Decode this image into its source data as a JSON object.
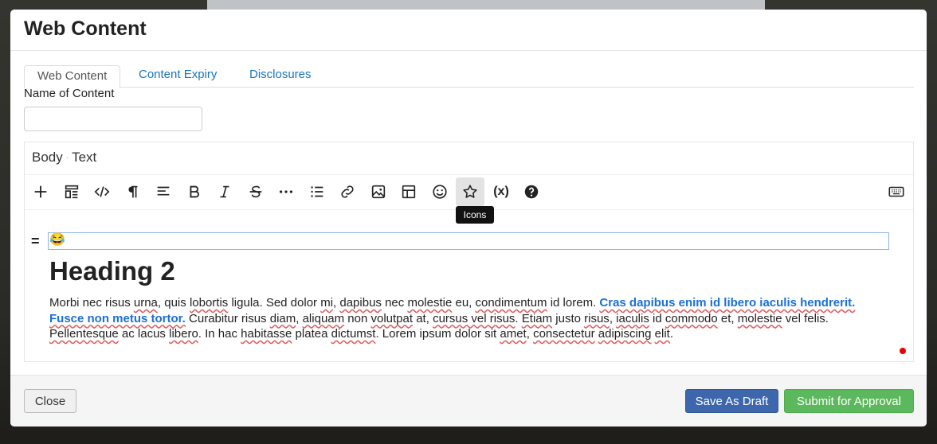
{
  "modal": {
    "title": "Web Content"
  },
  "tabs": [
    {
      "label": "Web Content",
      "active": true
    },
    {
      "label": "Content Expiry",
      "active": false
    },
    {
      "label": "Disclosures",
      "active": false
    }
  ],
  "form": {
    "name_label": "Name of Content",
    "name_value": ""
  },
  "editor": {
    "label_body": "Body",
    "label_text": "Text",
    "toolbar": [
      {
        "name": "plus-icon"
      },
      {
        "name": "layout-icon"
      },
      {
        "name": "code-icon"
      },
      {
        "name": "paragraph-icon"
      },
      {
        "name": "align-left-icon"
      },
      {
        "name": "bold-icon"
      },
      {
        "name": "italic-icon"
      },
      {
        "name": "strikethrough-icon"
      },
      {
        "name": "more-icon"
      },
      {
        "name": "list-icon"
      },
      {
        "name": "link-icon"
      },
      {
        "name": "image-icon"
      },
      {
        "name": "table-icon"
      },
      {
        "name": "emoji-icon"
      },
      {
        "name": "star-icon"
      },
      {
        "name": "variable-icon",
        "text": "(x)"
      },
      {
        "name": "help-icon"
      },
      {
        "name": "keyboard-icon"
      }
    ],
    "tooltip": "Icons",
    "drag_handle": "=",
    "emoji": "😂",
    "heading": "Heading 2",
    "paragraph": {
      "p1": "Morbi nec risus ",
      "w_urna": "urna",
      "p2": ", quis ",
      "w_lobortis": "lobortis",
      "p3": " ligula. Sed dolor ",
      "w_mi": "mi",
      "p4": ", ",
      "w_dapibus": "dapibus",
      "p5": " nec ",
      "w_molestie1": "molestie",
      "p6": " eu, ",
      "w_condimentum": "condimentum",
      "p7": " id lorem. ",
      "link1": "Cras dapibus enim id libero iaculis hendrerit.",
      "p8": " ",
      "link2": "Fusce non metus tortor.",
      "p9": " Curabitur risus ",
      "w_diam": "diam",
      "p10": ", ",
      "w_aliquam": "aliquam",
      "p11": " non ",
      "w_volutpat": "volutpat",
      "p12": " at, ",
      "w_cursus": "cursus vel risus",
      "p13": ". ",
      "w_etiam": "Etiam",
      "p14": " justo ",
      "w_risus": "risus",
      "p15": ", ",
      "w_iaculis": "iaculis",
      "p16": " id ",
      "w_commodo": "commodo",
      "p17": " et, ",
      "w_molestie2": "molestie",
      "p18": " vel felis. ",
      "w_pellentesque": "Pellentesque",
      "p19": " ac lacus ",
      "w_libero": "libero",
      "p20": ". In hac ",
      "w_habitasse": "habitasse",
      "p21": " platea ",
      "w_dictumst": "dictumst",
      "p22": ". Lorem ipsum dolor sit ",
      "w_amet": "amet",
      "p23": ", ",
      "w_consectetur": "consectetur",
      "p24": " ",
      "w_adipiscing": "adipiscing",
      "p25": " ",
      "w_elit": "elit",
      "p26": "."
    }
  },
  "footer": {
    "close_label": "Close",
    "draft_label": "Save As Draft",
    "submit_label": "Submit for Approval"
  },
  "colors": {
    "link": "#1a6fd6",
    "draft_button": "#3e66ac",
    "submit_button": "#5cb85c",
    "spellcheck": "#e2565a"
  }
}
